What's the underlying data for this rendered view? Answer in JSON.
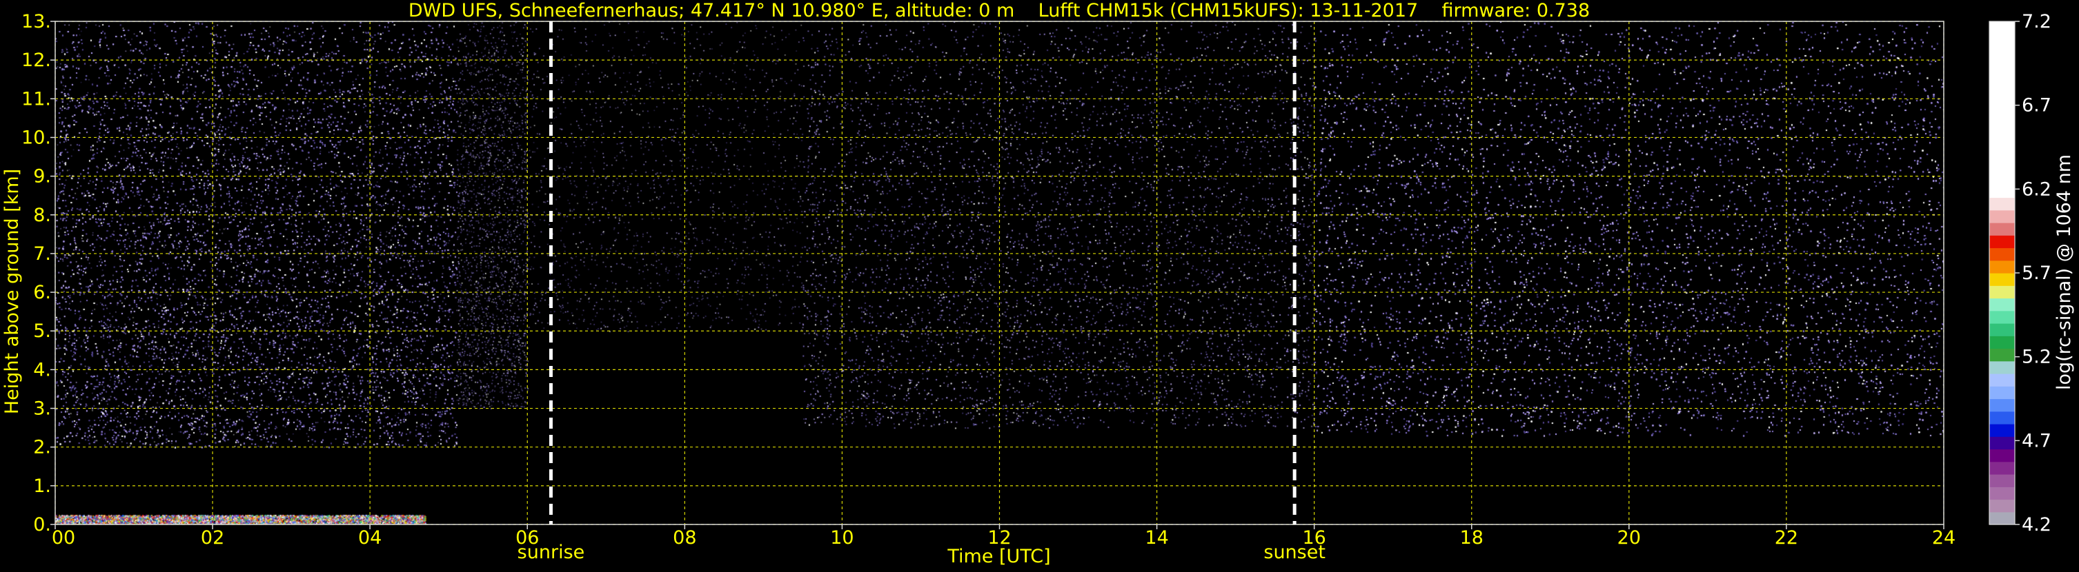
{
  "chart_data": {
    "type": "heatmap",
    "title": "DWD UFS, Schneefernerhaus; 47.417° N 10.980° E, altitude: 0 m    Lufft CHM15k (CHM15kUFS): 13-11-2017    firmware: 0.738",
    "xlabel": "Time [UTC]",
    "ylabel": "Height above ground [km]",
    "xlim": [
      0,
      24
    ],
    "ylim": [
      0,
      13
    ],
    "x_ticks": [
      "00",
      "02",
      "04",
      "06",
      "08",
      "10",
      "12",
      "14",
      "16",
      "18",
      "20",
      "22",
      "24"
    ],
    "y_ticks": [
      "0.",
      "1.",
      "2.",
      "3.",
      "4.",
      "5.",
      "6.",
      "7.",
      "8.",
      "9.",
      "10.",
      "11.",
      "12.",
      "13."
    ],
    "grid": true,
    "markers": [
      {
        "label": "sunrise",
        "x": 6.3
      },
      {
        "label": "sunset",
        "x": 15.75
      }
    ],
    "colorbar": {
      "label": "log(rc-signal) @ 1064 nm",
      "ticks": [
        "4.2",
        "4.7",
        "5.2",
        "5.7",
        "6.2",
        "6.7",
        "7.2"
      ],
      "range": [
        4.2,
        7.2
      ]
    },
    "background_noise": [
      {
        "from": 0,
        "to": 5.1,
        "min_height": 2.0,
        "density": 0.55
      },
      {
        "from": 5.1,
        "to": 6.0,
        "min_height": 3.0,
        "density": 0.2
      },
      {
        "from": 6.0,
        "to": 9.5,
        "min_height": 5.0,
        "density": 0.05
      },
      {
        "from": 9.5,
        "to": 16.0,
        "min_height": 2.5,
        "density": 0.14
      },
      {
        "from": 16.0,
        "to": 24.0,
        "min_height": 2.3,
        "density": 0.48
      }
    ],
    "cloud_layer": {
      "from": 0,
      "to": 4.7,
      "top_height": 0.25,
      "base_height": 0.0
    }
  },
  "colors": {
    "text": "#ffff00",
    "cbar_text": "#ffffff",
    "grid": "#ffff00",
    "marker_line": "#ffffff",
    "colorbar_segments": [
      "#a9a9b8",
      "#b28cb0",
      "#a870a8",
      "#9a559d",
      "#852a8e",
      "#6c0080",
      "#3a0098",
      "#0010d8",
      "#2a5cf0",
      "#5a8cfa",
      "#8ab0ff",
      "#a9c2ff",
      "#9fd2d2",
      "#3aa23a",
      "#1fa84a",
      "#31c27a",
      "#5de0a8",
      "#8ff0c8",
      "#e8f070",
      "#f8d000",
      "#f89000",
      "#f05000",
      "#e81000",
      "#e07878",
      "#f0b0b0",
      "#f8e0e0",
      "#ffffff",
      "#ffffff",
      "#ffffff",
      "#ffffff",
      "#ffffff",
      "#ffffff",
      "#ffffff",
      "#ffffff",
      "#ffffff",
      "#ffffff",
      "#ffffff",
      "#ffffff",
      "#ffffff",
      "#ffffff"
    ]
  }
}
